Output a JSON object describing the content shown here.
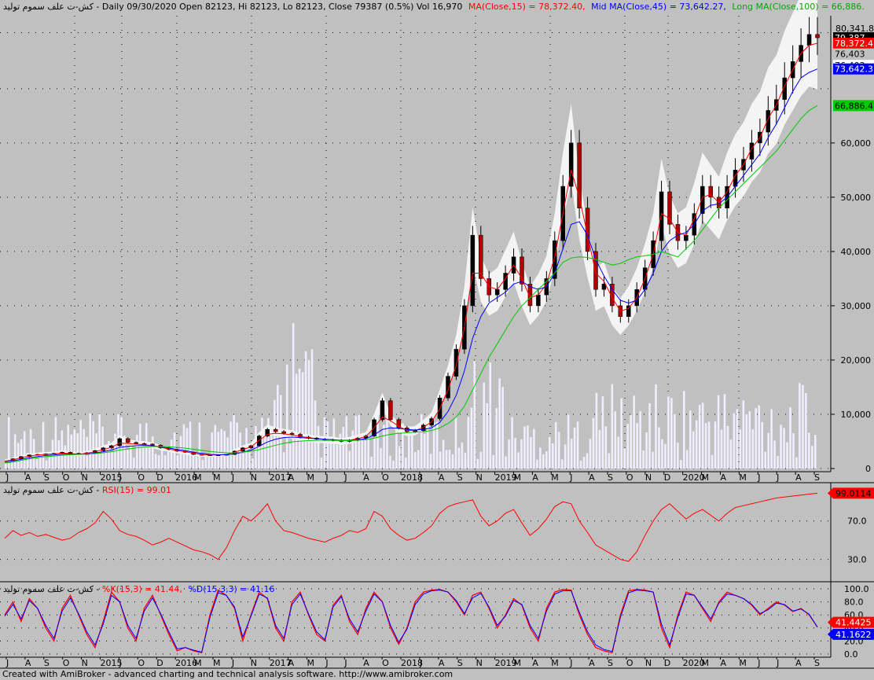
{
  "header": {
    "prefix": "كش-ت علف سموم توليد - Daily 09/30/2020 Open 82123, Hi 82123, Lo 82123, Close 79387 (0.5%) Vol 16,970",
    "ma15": "MA(Close,15) = 78,372.40,",
    "ma45": "Mid MA(Close,45) = 73,642.27,",
    "ma100": "Long MA(Close,100) = 66,886."
  },
  "rsi_header": {
    "prefix": "كش-ت علف سموم توليد - ",
    "label": "RSI(15) = 99.01"
  },
  "stoch_header": {
    "prefix": "كش-ت علف سموم توليد - ",
    "k": "%K(15,3) = 41.44,",
    "d": "%D(15,3,3) = 41.16"
  },
  "footer": "Created with AmiBroker - advanced charting and technical analysis software. http://www.amibroker.com",
  "colors": {
    "background": "#c0c0c0",
    "ma15": "#ff0000",
    "ma45": "#0000ff",
    "ma100": "#00c800",
    "rsi": "#ff0000",
    "stoch_k": "#ff0000",
    "stoch_d": "#0000ff",
    "volume": "#eeeeff",
    "band": "#f4f4f4"
  },
  "price_axis": {
    "ticks": [
      "0",
      "10,000",
      "20,000",
      "30,000",
      "40,000",
      "50,000",
      "60,000"
    ],
    "tick_values": [
      0,
      10000,
      20000,
      30000,
      40000,
      50000,
      60000
    ],
    "top_value": "80,341.8",
    "labels": [
      {
        "text": "79,387",
        "value": 79387,
        "bg": "#000000",
        "fg": "#ffffff"
      },
      {
        "text": "78,372.4",
        "value": 78372,
        "bg": "#ff0000",
        "fg": "#ffffff"
      },
      {
        "text": "76,403",
        "value": 76403,
        "bg": "#c0c0c0",
        "fg": "#000000"
      },
      {
        "text": "76,403",
        "value": 74300,
        "bg": "#ffffff",
        "fg": "#000000"
      },
      {
        "text": "73,642.3",
        "value": 73642,
        "bg": "#0000ff",
        "fg": "#ffffff"
      },
      {
        "text": "66,886.4",
        "value": 66886,
        "bg": "#00cc00",
        "fg": "#000000"
      }
    ]
  },
  "rsi_axis": {
    "ticks": [
      "70.0",
      "30.0"
    ],
    "tick_values": [
      70,
      30
    ],
    "value_label": "99.0114"
  },
  "stoch_axis": {
    "ticks": [
      "100.0",
      "80.0",
      "60.0",
      "40.0",
      "20.0",
      "0.0"
    ],
    "tick_values": [
      100,
      80,
      60,
      40,
      20,
      0
    ],
    "k_label": "41.4425",
    "d_label": "41.1622"
  },
  "x_axis_labels": [
    "J",
    "A",
    "S",
    "O",
    "N",
    "2015",
    "J",
    "O",
    "D",
    "2016",
    "M",
    "M",
    "J",
    "N",
    "2017",
    "A",
    "M",
    "J",
    "J",
    "A",
    "O",
    "2018",
    "J",
    "A",
    "S",
    "N",
    "2019",
    "M",
    "A",
    "M",
    "J",
    "A",
    "S",
    "O",
    "N",
    "D",
    "2020",
    "M",
    "A",
    "M",
    "J",
    "J",
    "A",
    "S"
  ],
  "chart_data": {
    "type": "line",
    "x_range": [
      "2014-07",
      "2020-09-30"
    ],
    "ylim": [
      0,
      82000
    ],
    "series": [
      {
        "name": "Close",
        "values": [
          1500,
          1800,
          2200,
          2500,
          2600,
          2700,
          2800,
          3000,
          2800,
          2600,
          2900,
          3300,
          3800,
          4200,
          5500,
          4800,
          4600,
          4500,
          4300,
          3800,
          3500,
          3200,
          3000,
          2600,
          2500,
          2400,
          2500,
          2600,
          3200,
          3800,
          4200,
          6000,
          7200,
          6800,
          6500,
          6300,
          5800,
          5600,
          5400,
          5300,
          5200,
          5000,
          5200,
          5600,
          6000,
          9000,
          12500,
          9000,
          7500,
          6800,
          7000,
          8000,
          9200,
          13000,
          17000,
          22000,
          30000,
          43000,
          35000,
          32000,
          33000,
          36000,
          39000,
          34000,
          30000,
          32000,
          35000,
          42000,
          52000,
          60000,
          48000,
          40000,
          33000,
          34000,
          30000,
          28000,
          30000,
          33000,
          37000,
          42000,
          51000,
          45000,
          42000,
          43000,
          47000,
          52000,
          50000,
          48000,
          52000,
          55000,
          57000,
          60000,
          62000,
          66000,
          68000,
          72000,
          75000,
          78000,
          80000,
          79387
        ]
      },
      {
        "name": "MA(Close,15)",
        "values": [
          1400,
          1600,
          2000,
          2300,
          2500,
          2600,
          2700,
          2850,
          2750,
          2650,
          2800,
          3100,
          3500,
          3900,
          4700,
          4600,
          4500,
          4400,
          4200,
          3900,
          3600,
          3300,
          3100,
          2800,
          2600,
          2500,
          2500,
          2600,
          3000,
          3500,
          4000,
          5200,
          6300,
          6500,
          6400,
          6200,
          5900,
          5700,
          5500,
          5400,
          5300,
          5100,
          5200,
          5500,
          5900,
          7500,
          9500,
          8800,
          7800,
          7000,
          7000,
          7600,
          8600,
          11000,
          14500,
          19000,
          26000,
          36000,
          36000,
          33500,
          33000,
          35000,
          37500,
          35000,
          31500,
          32000,
          34000,
          39000,
          47000,
          55000,
          50000,
          43000,
          36000,
          34500,
          31500,
          29000,
          29500,
          31500,
          35000,
          39500,
          47000,
          46000,
          43500,
          43000,
          46000,
          50000,
          50500,
          49000,
          51000,
          54000,
          56000,
          59000,
          61000,
          64500,
          67000,
          70500,
          73500,
          76500,
          78000,
          78372
        ]
      },
      {
        "name": "Mid MA(Close,45)",
        "values": [
          1200,
          1400,
          1700,
          2000,
          2200,
          2400,
          2500,
          2650,
          2700,
          2650,
          2700,
          2850,
          3100,
          3400,
          3900,
          4100,
          4200,
          4250,
          4200,
          4000,
          3800,
          3500,
          3300,
          3000,
          2800,
          2600,
          2550,
          2550,
          2700,
          3000,
          3400,
          4100,
          4900,
          5400,
          5700,
          5800,
          5700,
          5600,
          5500,
          5400,
          5300,
          5200,
          5200,
          5300,
          5500,
          6200,
          7200,
          7500,
          7400,
          7200,
          7100,
          7200,
          7500,
          8500,
          10500,
          13500,
          18000,
          24000,
          28000,
          30500,
          31500,
          32500,
          34000,
          34500,
          33500,
          33000,
          33500,
          36000,
          40500,
          45000,
          45500,
          43000,
          38500,
          35500,
          33000,
          31000,
          30500,
          31000,
          33000,
          36000,
          40000,
          42000,
          43000,
          43500,
          45000,
          47500,
          48500,
          48800,
          50000,
          52000,
          54000,
          56000,
          58000,
          61000,
          63500,
          66500,
          69500,
          72000,
          73000,
          73642
        ]
      },
      {
        "name": "Long MA(Close,100)",
        "values": [
          1000,
          1200,
          1500,
          1800,
          2000,
          2200,
          2300,
          2450,
          2550,
          2600,
          2650,
          2750,
          2900,
          3100,
          3400,
          3600,
          3800,
          3950,
          4050,
          4050,
          4000,
          3900,
          3750,
          3550,
          3350,
          3150,
          3000,
          2900,
          2900,
          3000,
          3200,
          3500,
          3900,
          4300,
          4650,
          4900,
          5050,
          5150,
          5200,
          5200,
          5200,
          5150,
          5150,
          5200,
          5300,
          5600,
          6000,
          6300,
          6500,
          6600,
          6700,
          6800,
          7000,
          7500,
          8300,
          9500,
          11500,
          14500,
          17500,
          20500,
          23000,
          25500,
          28000,
          30000,
          31500,
          33000,
          34500,
          36000,
          38000,
          38800,
          39000,
          38900,
          38500,
          38000,
          37500,
          37800,
          38500,
          39000,
          39200,
          39500,
          40000,
          39500,
          39000,
          40500,
          42000,
          44000,
          46000,
          48000,
          49500,
          51000,
          52500,
          54000,
          55500,
          57000,
          58500,
          60500,
          62500,
          64500,
          66000,
          66886
        ]
      },
      {
        "name": "RSI(15)",
        "values": [
          52,
          60,
          55,
          58,
          54,
          56,
          53,
          50,
          52,
          58,
          62,
          68,
          80,
          72,
          60,
          56,
          54,
          50,
          45,
          48,
          52,
          48,
          44,
          40,
          38,
          35,
          30,
          42,
          60,
          75,
          70,
          78,
          88,
          70,
          60,
          58,
          55,
          52,
          50,
          48,
          52,
          55,
          60,
          58,
          62,
          80,
          75,
          62,
          55,
          50,
          52,
          58,
          65,
          78,
          85,
          88,
          90,
          92,
          75,
          65,
          70,
          78,
          82,
          68,
          55,
          62,
          72,
          85,
          90,
          88,
          70,
          58,
          45,
          40,
          35,
          30,
          28,
          38,
          55,
          70,
          82,
          88,
          80,
          72,
          78,
          82,
          76,
          70,
          78,
          84,
          86,
          88,
          90,
          92,
          94,
          95,
          96,
          97,
          98,
          99
        ]
      },
      {
        "name": "%K(15,3)",
        "values": [
          60,
          80,
          50,
          85,
          70,
          40,
          20,
          70,
          90,
          60,
          30,
          10,
          50,
          95,
          80,
          40,
          20,
          70,
          90,
          60,
          30,
          5,
          10,
          5,
          2,
          60,
          98,
          90,
          70,
          20,
          60,
          95,
          85,
          40,
          20,
          80,
          95,
          60,
          30,
          20,
          75,
          90,
          50,
          30,
          70,
          95,
          80,
          40,
          15,
          40,
          80,
          95,
          98,
          99,
          95,
          80,
          60,
          90,
          95,
          70,
          40,
          60,
          85,
          75,
          40,
          20,
          70,
          95,
          99,
          98,
          60,
          30,
          10,
          5,
          2,
          60,
          97,
          99,
          98,
          95,
          40,
          10,
          60,
          95,
          90,
          70,
          50,
          80,
          95,
          90,
          85,
          75,
          60,
          70,
          80,
          75,
          65,
          70,
          60,
          41.4425
        ]
      },
      {
        "name": "%D(15,3,3)",
        "values": [
          58,
          76,
          54,
          82,
          70,
          44,
          24,
          66,
          86,
          62,
          34,
          14,
          46,
          90,
          80,
          44,
          24,
          66,
          86,
          62,
          34,
          8,
          10,
          6,
          3,
          56,
          94,
          90,
          72,
          26,
          58,
          92,
          86,
          44,
          24,
          76,
          92,
          62,
          34,
          22,
          72,
          88,
          54,
          34,
          66,
          92,
          80,
          44,
          18,
          38,
          76,
          92,
          97,
          98,
          95,
          82,
          62,
          86,
          93,
          72,
          44,
          58,
          82,
          76,
          44,
          24,
          66,
          92,
          97,
          97,
          64,
          34,
          14,
          7,
          4,
          56,
          94,
          98,
          97,
          95,
          46,
          14,
          56,
          92,
          90,
          72,
          54,
          78,
          92,
          90,
          85,
          76,
          62,
          68,
          78,
          76,
          66,
          69,
          61,
          41.1622
        ]
      }
    ]
  }
}
